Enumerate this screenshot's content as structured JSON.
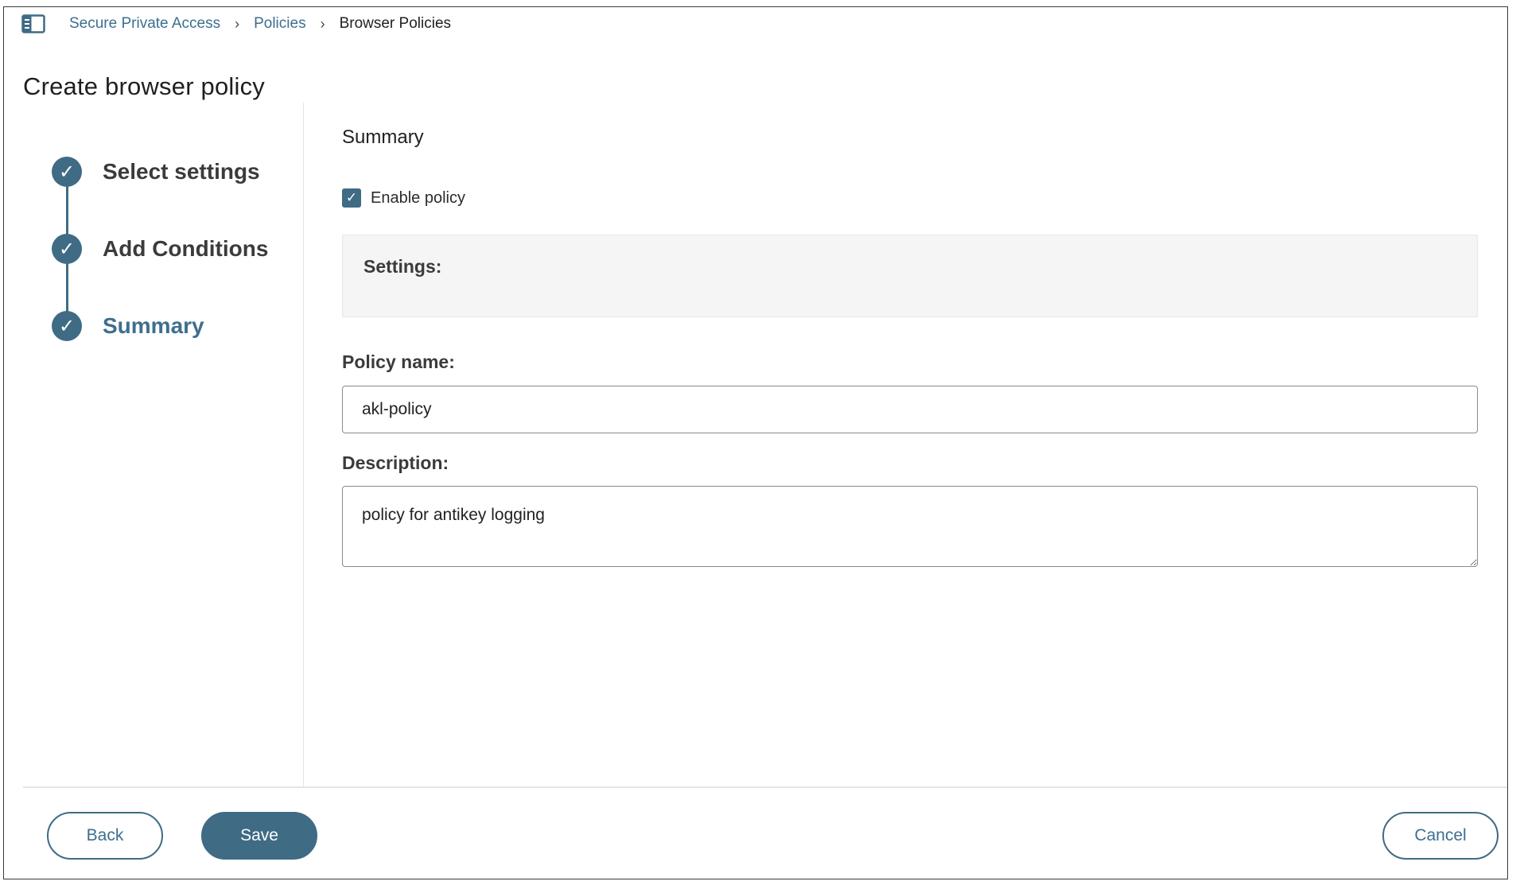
{
  "breadcrumb": {
    "items": [
      "Secure Private Access",
      "Policies"
    ],
    "current": "Browser Policies",
    "separator": "›"
  },
  "page": {
    "title": "Create browser policy"
  },
  "stepper": {
    "steps": [
      {
        "label": "Select settings",
        "status": "complete"
      },
      {
        "label": "Add Conditions",
        "status": "complete"
      },
      {
        "label": "Summary",
        "status": "active"
      }
    ],
    "check_glyph": "✓"
  },
  "summary": {
    "title": "Summary",
    "enable_policy_label": "Enable policy",
    "enable_policy_checked": true,
    "settings_label": "Settings:",
    "policy_name_label": "Policy name:",
    "policy_name_value": "akl-policy",
    "description_label": "Description:",
    "description_value": "policy for antikey logging"
  },
  "footer": {
    "back_label": "Back",
    "save_label": "Save",
    "cancel_label": "Cancel"
  },
  "colors": {
    "accent": "#3f6b85",
    "link": "#3d6f8f",
    "panel_bg": "#f5f5f5"
  },
  "icons": {
    "sidebar_toggle": "sidebar-toggle-icon",
    "step_complete": "check-icon",
    "checkbox": "check-icon"
  }
}
